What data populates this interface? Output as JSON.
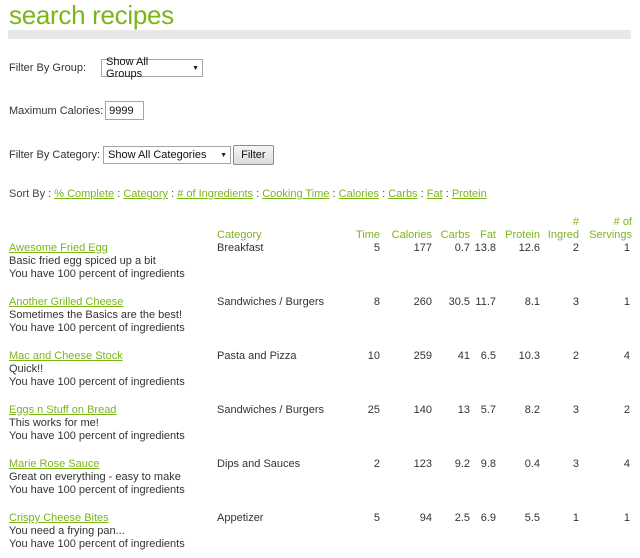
{
  "page": {
    "title": "search recipes"
  },
  "filters": {
    "group_label": "Filter By Group:",
    "group_value": "Show All Groups",
    "calories_label": "Maximum Calories:",
    "calories_value": "9999",
    "category_label": "Filter By Category:",
    "category_value": "Show All Categories",
    "filter_button": "Filter"
  },
  "sort": {
    "label": "Sort By :",
    "options": [
      "% Complete",
      "Category",
      "# of Ingredients",
      "Cooking Time",
      "Calories",
      "Carbs",
      "Fat",
      "Protein"
    ],
    "separator": ":"
  },
  "table": {
    "headers": {
      "category": "Category",
      "time": "Time",
      "calories": "Calories",
      "carbs": "Carbs",
      "fat": "Fat",
      "protein": "Protein",
      "ingred_1": "#",
      "ingred_2": "Ingred",
      "servings_1": "# of",
      "servings_2": "Servings"
    },
    "rows": [
      {
        "name": "Awesome Fried Egg",
        "desc": "Basic fried egg spiced up a bit",
        "pct": "You have 100 percent of ingredients",
        "category": "Breakfast",
        "time": "5",
        "calories": "177",
        "carbs": "0.7",
        "fat": "13.8",
        "protein": "12.6",
        "ingred": "2",
        "servings": "1"
      },
      {
        "name": "Another Grilled Cheese",
        "desc": "Sometimes the Basics are the best!",
        "pct": "You have 100 percent of ingredients",
        "category": "Sandwiches / Burgers",
        "time": "8",
        "calories": "260",
        "carbs": "30.5",
        "fat": "11.7",
        "protein": "8.1",
        "ingred": "3",
        "servings": "1"
      },
      {
        "name": "Mac and Cheese Stock",
        "desc": "Quick!!",
        "pct": "You have 100 percent of ingredients",
        "category": "Pasta and Pizza",
        "time": "10",
        "calories": "259",
        "carbs": "41",
        "fat": "6.5",
        "protein": "10.3",
        "ingred": "2",
        "servings": "4"
      },
      {
        "name": "Eggs n Stuff on Bread",
        "desc": "This works for me!",
        "pct": "You have 100 percent of ingredients",
        "category": "Sandwiches / Burgers",
        "time": "25",
        "calories": "140",
        "carbs": "13",
        "fat": "5.7",
        "protein": "8.2",
        "ingred": "3",
        "servings": "2"
      },
      {
        "name": "Marie Rose Sauce",
        "desc": "Great on everything - easy to make",
        "pct": "You have 100 percent of ingredients",
        "category": "Dips and Sauces",
        "time": "2",
        "calories": "123",
        "carbs": "9.2",
        "fat": "9.8",
        "protein": "0.4",
        "ingred": "3",
        "servings": "4"
      },
      {
        "name": "Crispy Cheese Bites",
        "desc": "You need a frying pan...",
        "pct": "You have 100 percent of ingredients",
        "category": "Appetizer",
        "time": "5",
        "calories": "94",
        "carbs": "2.5",
        "fat": "6.9",
        "protein": "5.5",
        "ingred": "1",
        "servings": "1"
      }
    ]
  },
  "colors": {
    "accent": "#7cb518",
    "text": "#333333",
    "rule": "#e8e8e8"
  }
}
